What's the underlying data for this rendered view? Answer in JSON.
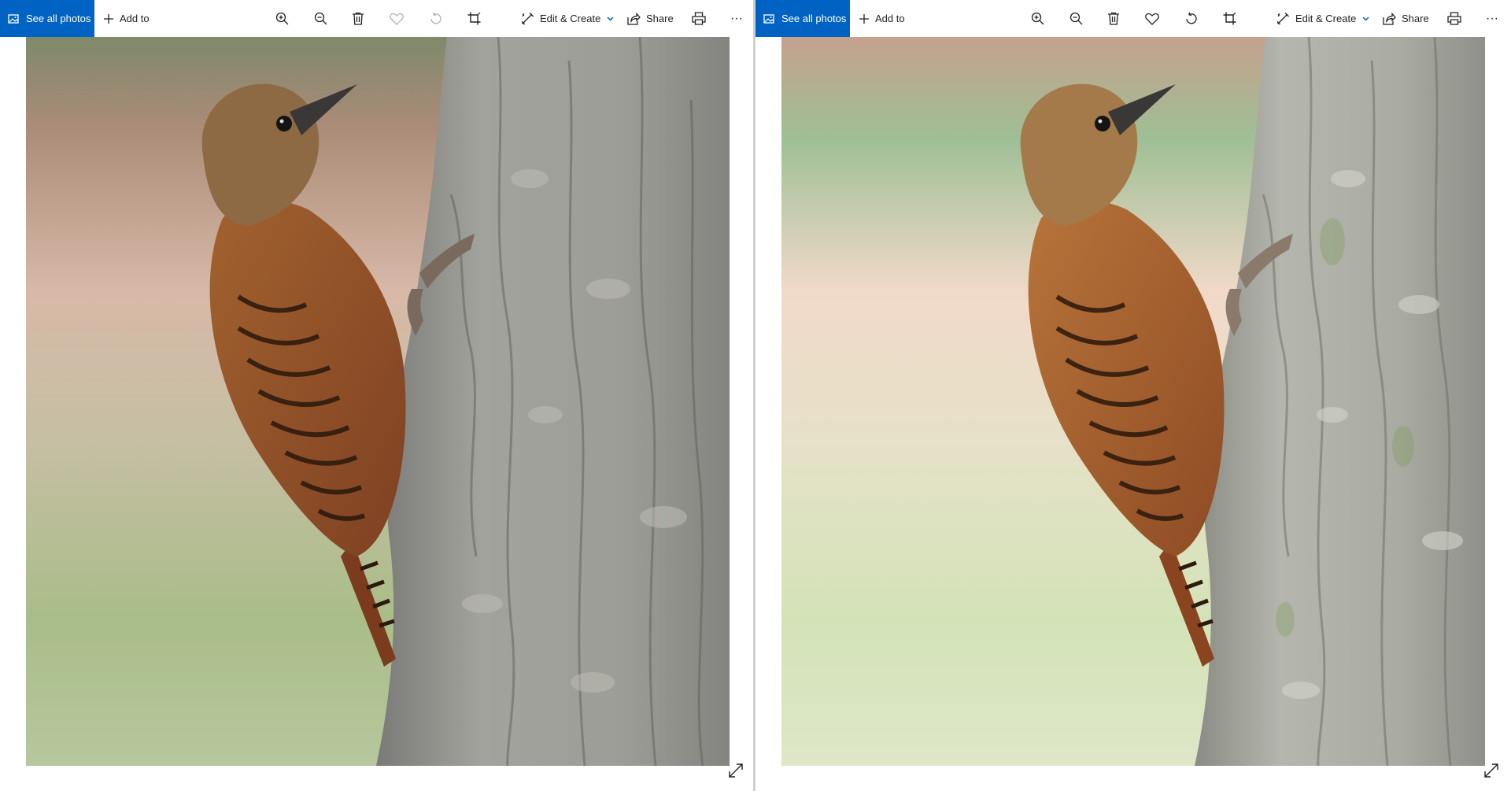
{
  "left_viewer": {
    "see_all_photos": "See all photos",
    "add_to": "Add to",
    "edit_create": "Edit & Create",
    "share": "Share",
    "more": "···",
    "favorite_enabled": false,
    "rotate_enabled": false
  },
  "right_viewer": {
    "see_all_photos": "See all photos",
    "add_to": "Add to",
    "edit_create": "Edit & Create",
    "share": "Share",
    "more": "···",
    "favorite_enabled": true,
    "rotate_enabled": true
  },
  "colors": {
    "accent": "#0063c4",
    "toolbar_text": "#1f1f1f",
    "bark": "#9a9a95",
    "bird_body": "#9a5428",
    "bird_head": "#8e6a44"
  },
  "icons": {
    "photos": "photos-icon",
    "add": "plus-icon",
    "zoom_in": "zoom-in-icon",
    "zoom_out": "zoom-out-icon",
    "delete": "trash-icon",
    "favorite": "heart-icon",
    "rotate": "rotate-icon",
    "crop": "crop-icon",
    "edit": "edit-create-icon",
    "share": "share-icon",
    "print": "printer-icon",
    "expand": "expand-icon"
  }
}
